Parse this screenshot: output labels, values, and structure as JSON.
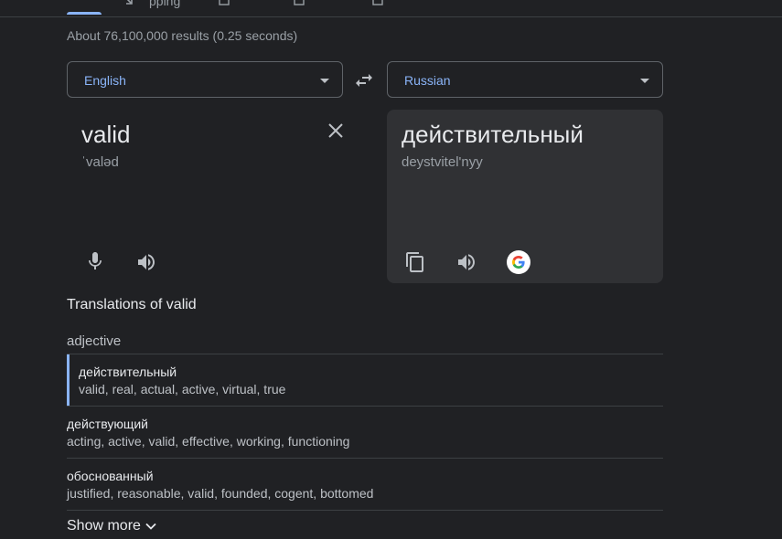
{
  "tabs": {
    "fragments": [
      "pping"
    ]
  },
  "result_stats": "About 76,100,000 results (0.25 seconds)",
  "source_language": {
    "label": "English",
    "icon": "chevron-down-icon"
  },
  "target_language": {
    "label": "Russian",
    "icon": "chevron-down-icon"
  },
  "swap": {
    "icon": "swap-arrows-icon"
  },
  "source": {
    "text": "valid",
    "transliteration": "ˈvaləd",
    "icons": [
      "close-icon",
      "microphone-icon",
      "speaker-icon"
    ]
  },
  "target": {
    "text": "действительный",
    "transliteration": "deystvitel'nyy",
    "icons": [
      "copy-icon",
      "speaker-icon",
      "google-icon"
    ]
  },
  "translations": {
    "heading": "Translations of valid",
    "part_of_speech": "adjective",
    "entries": [
      {
        "word": "действительный",
        "synonyms": "valid, real, actual, active, virtual, true"
      },
      {
        "word": "действующий",
        "synonyms": "acting, active, valid, effective, working, functioning"
      },
      {
        "word": "обоснованный",
        "synonyms": "justified, reasonable, valid, founded, cogent, bottomed"
      }
    ],
    "show_more": "Show more"
  },
  "colors": {
    "background": "#202124",
    "panel": "#303134",
    "accent": "#8ab4f8",
    "text_primary": "#e8eaed",
    "text_secondary": "#9aa0a6"
  }
}
